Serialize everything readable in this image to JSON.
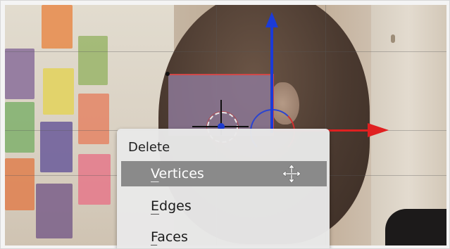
{
  "menu": {
    "title": "Delete",
    "items": [
      {
        "mnemonic": "V",
        "rest": "ertices",
        "active": true,
        "icon": "move-cursor-icon"
      },
      {
        "mnemonic": "E",
        "rest": "dges",
        "active": false
      },
      {
        "mnemonic": "F",
        "rest": "aces",
        "active": false
      }
    ]
  },
  "colors": {
    "x_axis": "#e02020",
    "z_axis": "#1b3bd8",
    "menu_bg": "#e8e8e8",
    "menu_highlight": "#8a8a8a"
  }
}
